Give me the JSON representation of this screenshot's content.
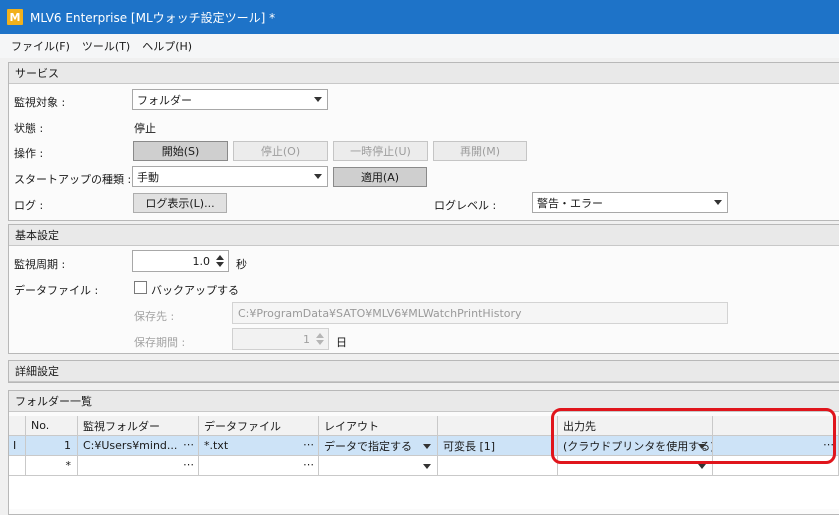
{
  "window": {
    "title": "MLV6 Enterprise [MLウォッチ設定ツール] *",
    "icon_letter": "M",
    "brand_color": "#1e73c8",
    "icon_color": "#f1b11c"
  },
  "menu": {
    "items": [
      "ファイル(F)",
      "ツール(T)",
      "ヘルプ(H)"
    ]
  },
  "service": {
    "header": "サービス",
    "target_label": "監視対象 :",
    "target_value": "フォルダー",
    "status_label": "状態 :",
    "status_value": "停止",
    "operation_label": "操作 :",
    "btn_start": "開始(S)",
    "btn_stop": "停止(O)",
    "btn_pause": "一時停止(U)",
    "btn_resume": "再開(M)",
    "startup_label": "スタートアップの種類 :",
    "startup_value": "手動",
    "btn_apply": "適用(A)",
    "log_label": "ログ :",
    "btn_log": "ログ表示(L)...",
    "loglevel_label": "ログレベル :",
    "loglevel_value": "警告・エラー"
  },
  "basic": {
    "header": "基本設定",
    "interval_label": "監視周期 :",
    "interval_value": "1.0",
    "interval_unit": "秒",
    "datafile_label": "データファイル :",
    "backup_label": "バックアップする",
    "backup_checked": false,
    "save_to_label": "保存先 :",
    "save_to_value": "C:¥ProgramData¥SATO¥MLV6¥MLWatchPrintHistory",
    "save_period_label": "保存期間 :",
    "save_period_value": "1",
    "save_period_unit": "日"
  },
  "detail": {
    "header": "詳細設定"
  },
  "folders": {
    "header": "フォルダー一覧",
    "columns": [
      "No.",
      "監視フォルダー",
      "データファイル",
      "レイアウト",
      "",
      "出力先",
      ""
    ],
    "row1": {
      "indicator": "I",
      "no": "1",
      "folder": "C:¥Users¥mind...",
      "datafile": "*.txt",
      "layout": "データで指定する",
      "length": "可変長 [1]",
      "output": "(クラウドプリンタを使用する)"
    },
    "row_new": {
      "indicator": "*"
    },
    "highlight_color": "#e0151c"
  }
}
